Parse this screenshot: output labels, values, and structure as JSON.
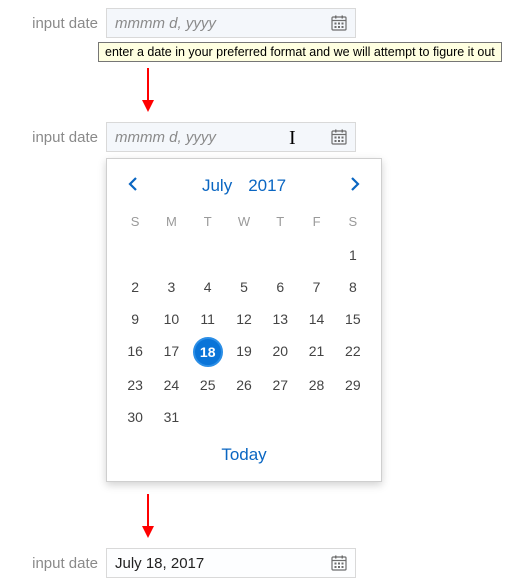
{
  "state1": {
    "label": "input date",
    "placeholder": "mmmm d, yyyy",
    "tooltip": "enter a date in your preferred format and we will attempt to figure it out"
  },
  "state2": {
    "label": "input date",
    "placeholder": "mmmm d, yyyy"
  },
  "calendar": {
    "month": "July",
    "year": "2017",
    "dow": [
      "S",
      "M",
      "T",
      "W",
      "T",
      "F",
      "S"
    ],
    "leading_blanks": 6,
    "days": 31,
    "selected": 18,
    "today_label": "Today"
  },
  "state3": {
    "label": "input date",
    "value": "July 18, 2017"
  }
}
